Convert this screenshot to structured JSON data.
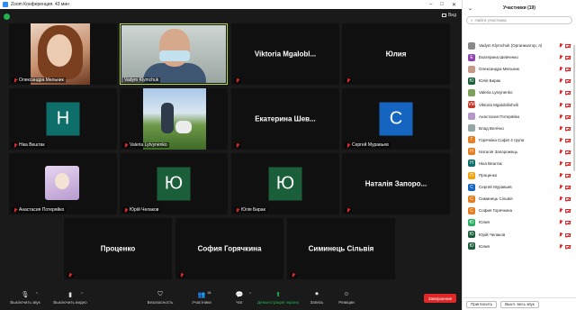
{
  "window": {
    "title": "Zoom Конференция. 43 мин"
  },
  "meeting": {
    "view_label": "Вид",
    "tiles": [
      {
        "type": "photo",
        "label": "Олександра Мельник",
        "muted": true
      },
      {
        "type": "photo",
        "label": "Vadym Klymchuk",
        "muted": false,
        "active": true
      },
      {
        "type": "name",
        "name": "Viktoria Mgalobl...",
        "muted": true
      },
      {
        "type": "name",
        "name": "Юлия",
        "muted": true
      },
      {
        "type": "avatar",
        "letter": "Н",
        "color": "#0e6e6a",
        "label": "Ніка Вештак",
        "muted": true
      },
      {
        "type": "photo",
        "label": "Valeria Lytvynenko",
        "muted": true
      },
      {
        "type": "name",
        "name": "Екатерина Шев...",
        "muted": true
      },
      {
        "type": "avatar",
        "letter": "С",
        "color": "#1565c0",
        "label": "Сергей Муравьев",
        "muted": true
      },
      {
        "type": "photo",
        "label": "Анастасия Потеряйко",
        "muted": true
      },
      {
        "type": "avatar",
        "letter": "Ю",
        "color": "#1b5e3a",
        "label": "Юрій Челаков",
        "muted": true
      },
      {
        "type": "avatar",
        "letter": "Ю",
        "color": "#1b5e3a",
        "label": "Юлія Бирак",
        "muted": true
      },
      {
        "type": "name",
        "name": "Наталія Запоро...",
        "muted": true
      },
      {
        "type": "name",
        "name": "Проценко",
        "muted": true
      },
      {
        "type": "name",
        "name": "София Горячкина",
        "muted": true
      },
      {
        "type": "name",
        "name": "Симинець Сільвія",
        "muted": true
      }
    ]
  },
  "toolbar": {
    "items": [
      {
        "label": "Выключить звук",
        "icon": "mic-icon"
      },
      {
        "label": "Выключить видео",
        "icon": "video-icon"
      },
      {
        "label": "Безопасность",
        "icon": "shield-icon"
      },
      {
        "label": "Участники",
        "icon": "participants-icon",
        "count": "15"
      },
      {
        "label": "Чат",
        "icon": "chat-icon"
      },
      {
        "label": "Демонстрация экрана",
        "icon": "share-screen-icon"
      },
      {
        "label": "Запись",
        "icon": "record-icon"
      },
      {
        "label": "Реакции",
        "icon": "reactions-icon"
      }
    ],
    "end_label": "Завершение"
  },
  "panel": {
    "title": "Участники (19)",
    "search_placeholder": "Найти участника",
    "participants": [
      {
        "name": "Vadym Klymchuk (Организатор, я)",
        "letter": "",
        "color": "#888888",
        "photo": true
      },
      {
        "name": "Екатерина Шевченко",
        "letter": "Е",
        "color": "#8e44ad"
      },
      {
        "name": "Олександра Мельник",
        "letter": "",
        "color": "#c49a86",
        "photo": true
      },
      {
        "name": "Юлія Бирак",
        "letter": "Ю",
        "color": "#1b5e3a"
      },
      {
        "name": "Valeria Lytvynenko",
        "letter": "",
        "color": "#7aa05a",
        "photo": true
      },
      {
        "name": "Viktoria Mgalobilishvili",
        "letter": "VM",
        "color": "#c0392b"
      },
      {
        "name": "Анастасия Потеряйко",
        "letter": "",
        "color": "#b59ac9",
        "photo": true
      },
      {
        "name": "Влад Велічко",
        "letter": "",
        "color": "#95a5a6",
        "photo": true
      },
      {
        "name": "Горячкіна Софія 4 група",
        "letter": "Г",
        "color": "#e67e22"
      },
      {
        "name": "Наталія Запорожець",
        "letter": "Н",
        "color": "#e67e22"
      },
      {
        "name": "Ніка Вештак",
        "letter": "Н",
        "color": "#0e6e6a"
      },
      {
        "name": "Проценко",
        "letter": "П",
        "color": "#f1a20f"
      },
      {
        "name": "Сергей Муравьев",
        "letter": "С",
        "color": "#1565c0"
      },
      {
        "name": "Симинець Сільвія",
        "letter": "С",
        "color": "#e67e22"
      },
      {
        "name": "София Горячкина",
        "letter": "С",
        "color": "#e67e22"
      },
      {
        "name": "Юлия",
        "letter": "Ю",
        "color": "#27ae60"
      },
      {
        "name": "Юрій Челаков",
        "letter": "Ю",
        "color": "#1b5e3a"
      },
      {
        "name": "Юлия",
        "letter": "Ю",
        "color": "#1b5e3a"
      }
    ],
    "invite_label": "Пригласить",
    "mute_all_label": "Выкл. весь звук"
  }
}
